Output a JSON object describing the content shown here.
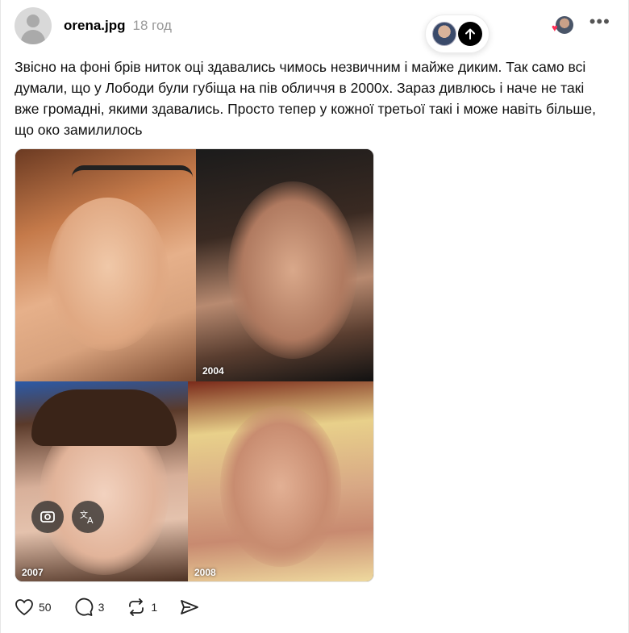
{
  "post": {
    "username": "orena.jpg",
    "time": "18 год",
    "text": "Звісно на фоні брів ниток оці здавались чимось незвичним і майже диким. Так само всі думали, що у Лободи були губіща на пів обличчя в 2000х. Зараз дивлюсь і наче не такі вже громадні, якими здавались. Просто тепер у кожної третьої такі і може навіть більше, що око замилилось"
  },
  "photo": {
    "labels": [
      "2004",
      "2007",
      "2008"
    ]
  },
  "actions": {
    "likes": "50",
    "comments": "3",
    "reposts": "1"
  },
  "colors": {
    "like_heart": "#ff2d55",
    "text": "#111111",
    "muted": "#999999"
  },
  "icons": [
    "avatar-icon",
    "arrow-up-icon",
    "more-icon",
    "lens-icon",
    "translate-icon",
    "heart-icon",
    "comment-icon",
    "repost-icon",
    "share-icon"
  ]
}
